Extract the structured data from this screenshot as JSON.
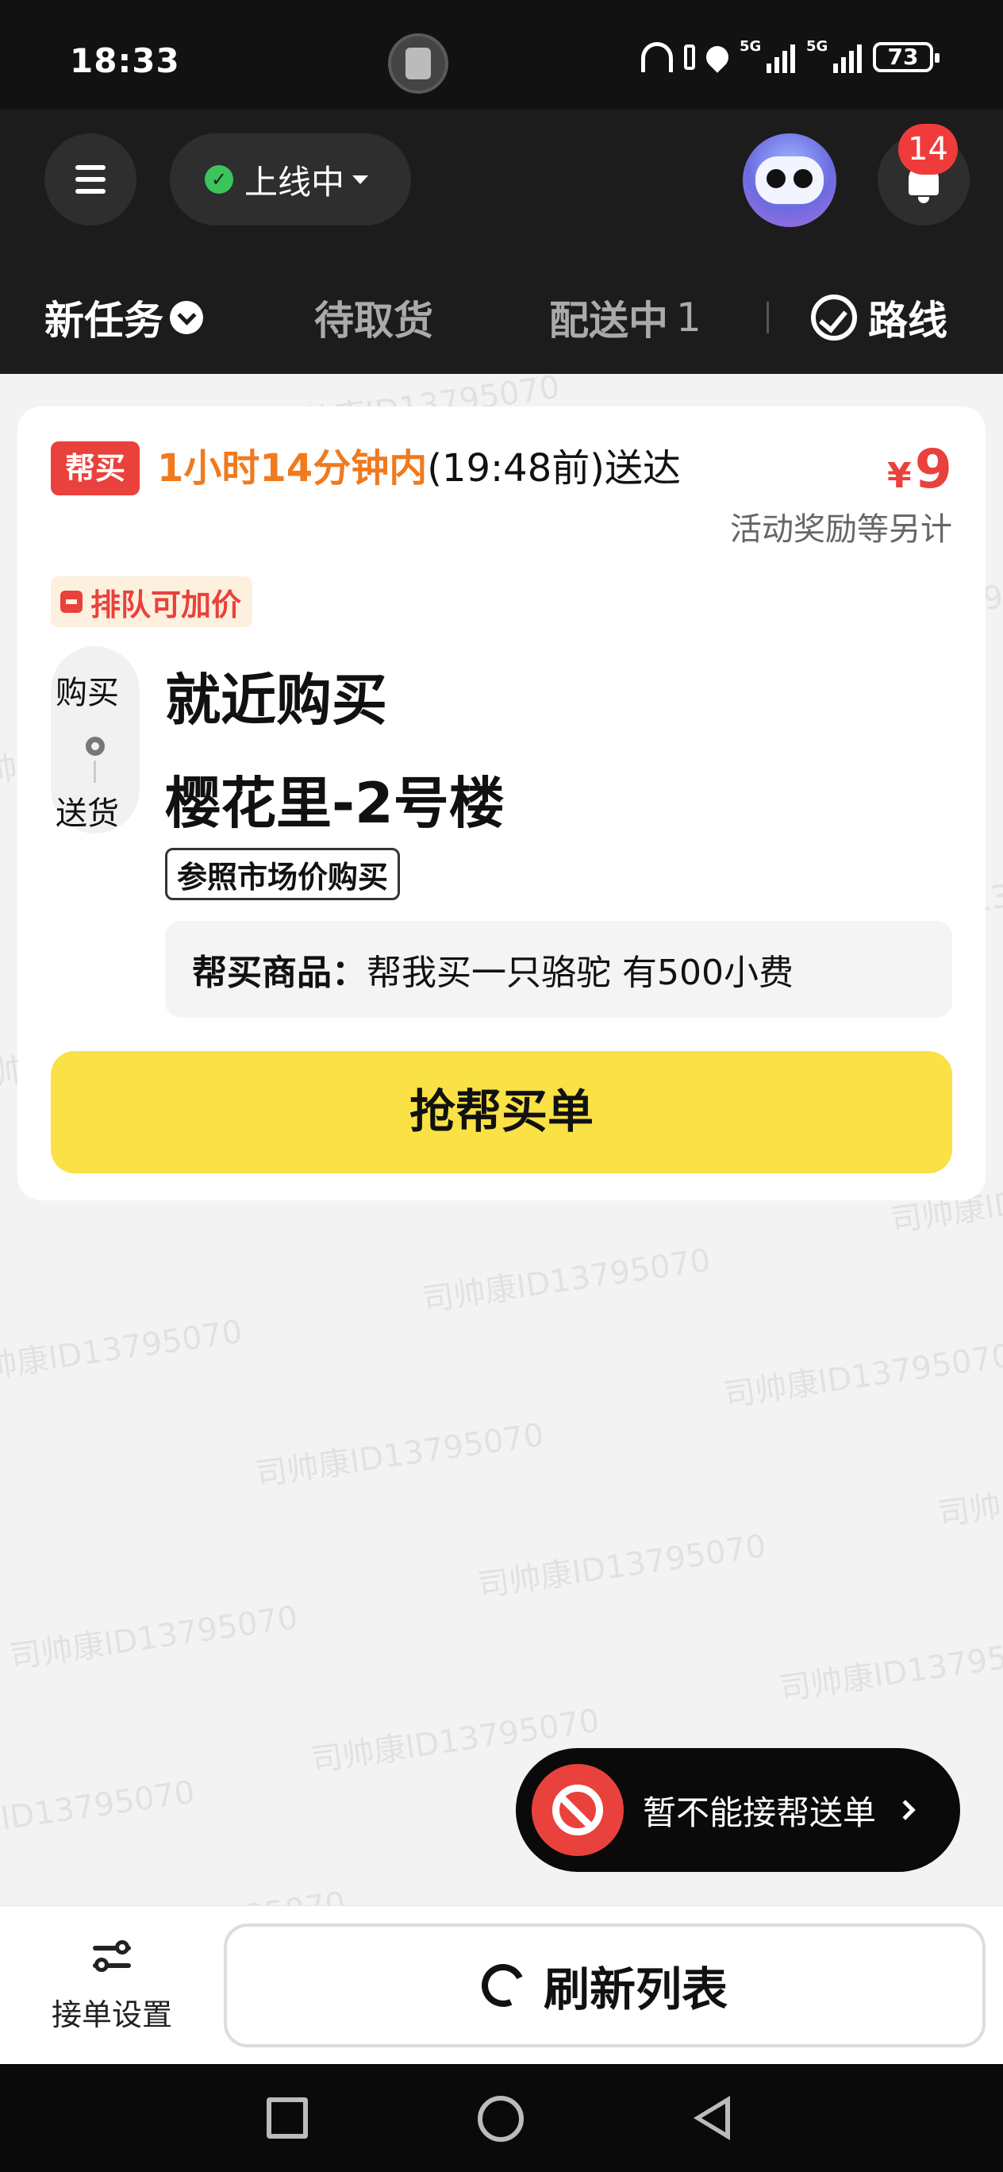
{
  "status_bar": {
    "time": "18:33",
    "signal1_label": "5G",
    "signal2_label": "5G",
    "battery": "73"
  },
  "header": {
    "online_status": "上线中",
    "notification_count": "14"
  },
  "tabs": {
    "new_tasks": "新任务",
    "to_pickup": "待取货",
    "delivering": "配送中",
    "delivering_count": "1",
    "route": "路线"
  },
  "order": {
    "type_tag": "帮买",
    "deadline_highlight": "1小时14分钟内",
    "deadline_rest": "(19:48前)送达",
    "price_symbol": "¥",
    "price": "9",
    "reward_note": "活动奖励等另计",
    "queue_tag": "排队可加价",
    "route_buy_label": "购买",
    "route_send_label": "送货",
    "from": "就近购买",
    "to": "樱花里-2号楼",
    "market_tag": "参照市场价购买",
    "goods_label": "帮买商品：",
    "goods_value": "帮我买一只骆驼 有500小费",
    "grab_button": "抢帮买单"
  },
  "watermark": "司帅康ID13795070",
  "notice": {
    "text": "暂不能接帮送单"
  },
  "bottom": {
    "settings_label": "接单设置",
    "refresh_label": "刷新列表"
  },
  "colors": {
    "accent_yellow": "#fae145",
    "accent_red": "#e9413b",
    "highlight_orange": "#f07a1e",
    "header_bg": "#1c1c1c"
  },
  "icons": [
    "menu-icon",
    "check-icon",
    "robot-icon",
    "bell-icon",
    "chevron-down-icon",
    "route-icon",
    "location-pin-icon",
    "ban-icon",
    "chevron-right-icon",
    "settings-icon",
    "refresh-icon"
  ]
}
